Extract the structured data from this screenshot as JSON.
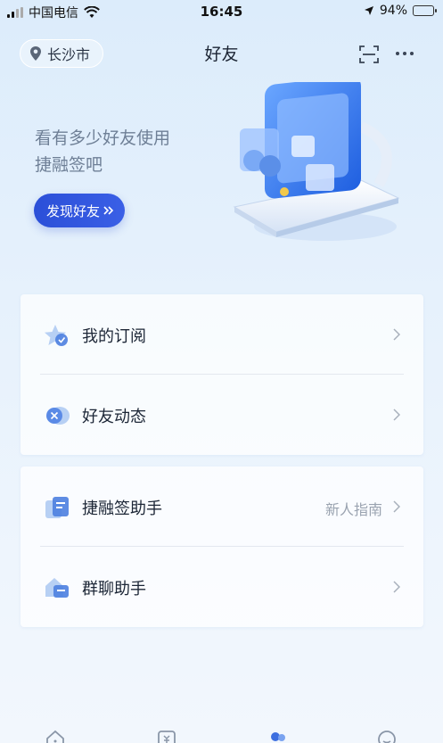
{
  "status_bar": {
    "carrier": "中国电信",
    "time": "16:45",
    "battery_percent": "94%",
    "battery_level": 0.94
  },
  "header": {
    "city": "长沙市",
    "title": "好友"
  },
  "hero": {
    "text": "看有多少好友使用捷融签吧",
    "button_label": "发现好友"
  },
  "list_group_1": [
    {
      "label": "我的订阅",
      "icon": "star-icon"
    },
    {
      "label": "好友动态",
      "icon": "friends-activity-icon"
    }
  ],
  "list_group_2": [
    {
      "label": "捷融签助手",
      "extra": "新人指南",
      "icon": "assistant-icon"
    },
    {
      "label": "群聊助手",
      "icon": "group-chat-icon"
    }
  ],
  "tabbar": {
    "icons": [
      "home-icon",
      "finance-icon",
      "friends-icon",
      "profile-icon"
    ],
    "active_index": 2
  },
  "colors": {
    "accent": "#2b4fd8",
    "background": "#e6f1fc",
    "muted_text": "#6e7f96"
  }
}
